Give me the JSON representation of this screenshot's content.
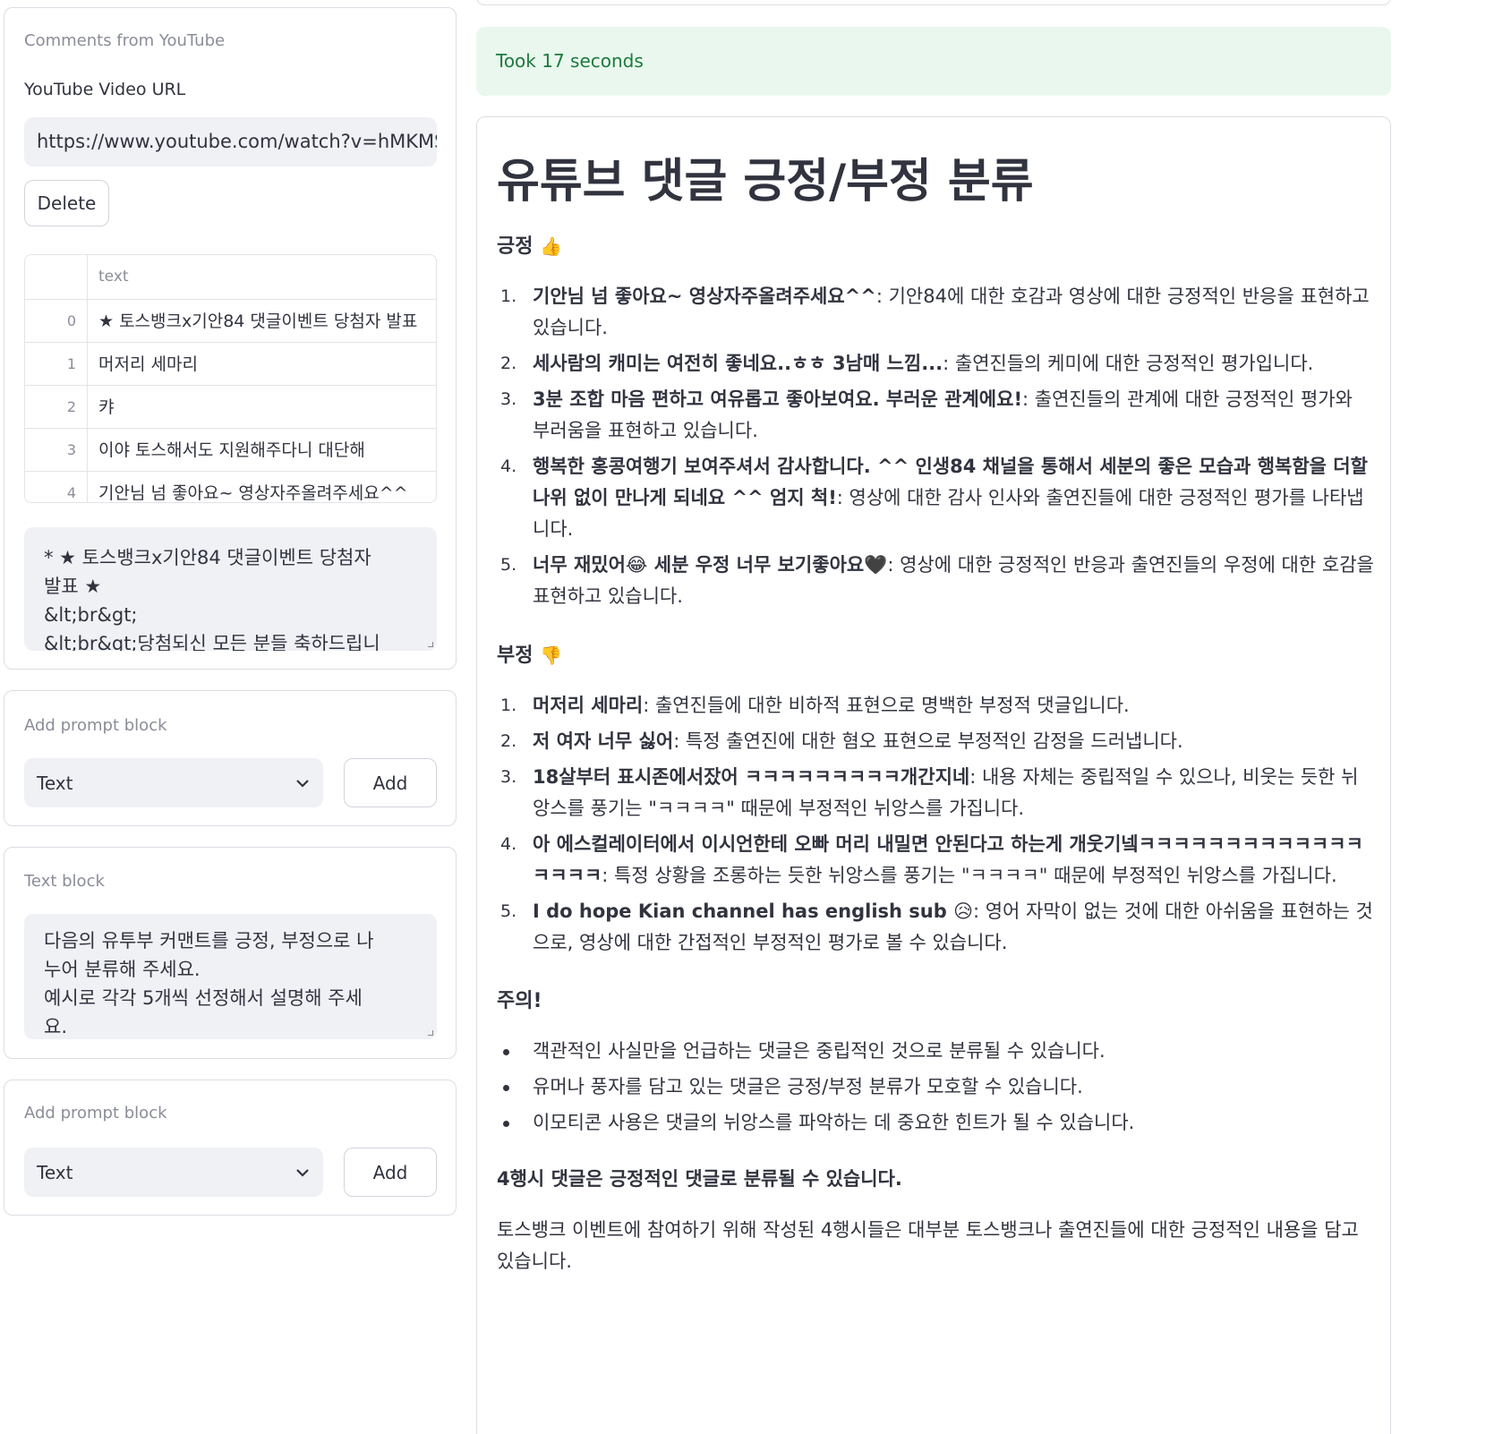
{
  "left": {
    "comments_card": {
      "label": "Comments from YouTube",
      "url_label": "YouTube Video URL",
      "url_value": "https://www.youtube.com/watch?v=hMKMSRKV",
      "delete_label": "Delete",
      "table": {
        "column": "text",
        "rows": [
          {
            "index": "0",
            "text": "★ 토스뱅크x기안84 댓글이벤트 당첨자 발표"
          },
          {
            "index": "1",
            "text": "머저리 세마리"
          },
          {
            "index": "2",
            "text": "캬"
          },
          {
            "index": "3",
            "text": "이야 토스해서도 지원해주다니 대단해"
          },
          {
            "index": "4",
            "text": "기안님 넘 좋아요~ 영상자주올려주세요^^"
          }
        ]
      },
      "preview_lines": [
        "* ★ 토스뱅크x기안84 댓글이벤트 당첨자",
        "발표 ★",
        "&lt;br&gt;",
        "&lt;br&gt;당첨되신 모든 분들 축하드립니"
      ]
    },
    "add_block_1": {
      "label": "Add prompt block",
      "select_value": "Text",
      "add_label": "Add"
    },
    "text_block": {
      "label": "Text block",
      "lines": [
        "다음의 유투부 커맨트를 긍정, 부정으로 나",
        "누어 분류해 주세요.",
        "예시로 각각 5개씩 선정해서 설명해 주세",
        "요."
      ]
    },
    "add_block_2": {
      "label": "Add prompt block",
      "select_value": "Text",
      "add_label": "Add"
    }
  },
  "right": {
    "success": "Took 17 seconds",
    "title": "유튜브 댓글 긍정/부정 분류",
    "positive": {
      "heading": "긍정",
      "icon": "thumbs-up-icon",
      "items": [
        {
          "n": "1.",
          "bold": "기안님 넘 좋아요~ 영상자주올려주세요^^",
          "rest": ": 기안84에 대한 호감과 영상에 대한 긍정적인 반응을 표현하고 있습니다."
        },
        {
          "n": "2.",
          "bold": "세사람의 캐미는 여전히 좋네요..ㅎㅎ 3남매 느낌...",
          "rest": ": 출연진들의 케미에 대한 긍정적인 평가입니다."
        },
        {
          "n": "3.",
          "bold": "3분 조합 마음 편하고 여유롭고 좋아보여요. 부러운 관계에요!",
          "rest": ": 출연진들의 관계에 대한 긍정적인 평가와 부러움을 표현하고 있습니다."
        },
        {
          "n": "4.",
          "bold": "행복한 홍콩여행기 보여주셔서 감사합니다. ^^ 인생84 채널을 통해서 세분의 좋은 모습과 행복함을 더할나위 없이 만나게 되네요 ^^ 엄지 척!",
          "rest": ": 영상에 대한 감사 인사와 출연진들에 대한 긍정적인 평가를 나타냅니다."
        },
        {
          "n": "5.",
          "bold": "너무 재밌어😂 세분 우정 너무 보기좋아요🖤",
          "rest": ": 영상에 대한 긍정적인 반응과 출연진들의 우정에 대한 호감을 표현하고 있습니다."
        }
      ]
    },
    "negative": {
      "heading": "부정",
      "icon": "thumbs-down-icon",
      "items": [
        {
          "n": "1.",
          "bold": "머저리 세마리",
          "rest": ": 출연진들에 대한 비하적 표현으로 명백한 부정적 댓글입니다."
        },
        {
          "n": "2.",
          "bold": "저 여자 너무 싫어",
          "rest": ": 특정 출연진에 대한 혐오 표현으로 부정적인 감정을 드러냅니다."
        },
        {
          "n": "3.",
          "bold": "18살부터 표시존에서잤어 ㅋㅋㅋㅋㅋㅋㅋㅋㅋ개간지네",
          "rest": ": 내용 자체는 중립적일 수 있으나, 비웃는 듯한 뉘앙스를 풍기는 \"ㅋㅋㅋㅋ\" 때문에 부정적인 뉘앙스를 가집니다."
        },
        {
          "n": "4.",
          "bold": "아 에스컬레이터에서 이시언한테 오빠 머리 내밀면 안된다고 하는게 개웃기넼ㅋㅋㅋㅋㅋㅋㅋㅋㅋㅋㅋㅋㅋㅋㅋㅋㅋ",
          "rest": ": 특정 상황을 조롱하는 듯한 뉘앙스를 풍기는 \"ㅋㅋㅋㅋ\" 때문에 부정적인 뉘앙스를 가집니다."
        },
        {
          "n": "5.",
          "bold": "I do hope Kian channel has english sub 😥",
          "rest": ": 영어 자막이 없는 것에 대한 아쉬움을 표현하는 것으로, 영상에 대한 간접적인 부정적인 평가로 볼 수 있습니다."
        }
      ]
    },
    "note": {
      "heading": "주의!",
      "bullets": [
        "객관적인 사실만을 언급하는 댓글은 중립적인 것으로 분류될 수 있습니다.",
        "유머나 풍자를 담고 있는 댓글은 긍정/부정 분류가 모호할 수 있습니다.",
        "이모티콘 사용은 댓글의 뉘앙스를 파악하는 데 중요한 힌트가 될 수 있습니다."
      ]
    },
    "conclusion_bold": "4행시 댓글은 긍정적인 댓글로 분류될 수 있습니다.",
    "conclusion_text": "토스뱅크 이벤트에 참여하기 위해 작성된 4행시들은 대부분 토스뱅크나 출연진들에 대한 긍정적인 내용을 담고 있습니다."
  }
}
